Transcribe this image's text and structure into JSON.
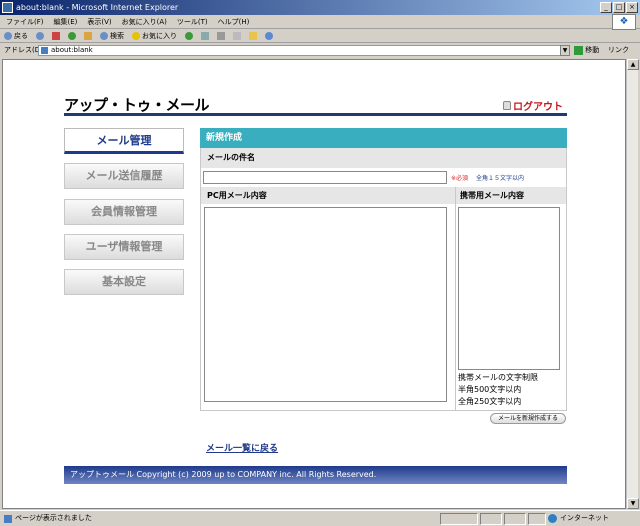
{
  "window": {
    "title": "about:blank - Microsoft Internet Explorer",
    "controls": [
      "_",
      "□",
      "×"
    ]
  },
  "menubar": [
    "ファイル(F)",
    "編集(E)",
    "表示(V)",
    "お気に入り(A)",
    "ツール(T)",
    "ヘルプ(H)"
  ],
  "toolbar": {
    "back": "戻る",
    "search": "検索",
    "favorites": "お気に入り"
  },
  "addressbar": {
    "label": "アドレス(D)",
    "url": "about:blank",
    "go": "移動",
    "links": "リンク"
  },
  "page": {
    "logo": "アップ・トゥ・メール",
    "logout": "ログアウト",
    "nav": [
      "メール管理",
      "メール送信履歴",
      "会員情報管理",
      "ユーザ情報管理",
      "基本設定"
    ],
    "panel_title": "新規作成",
    "subject_label": "メールの件名",
    "subject_value": "",
    "required": "※必須",
    "limit": "全角１５文字以内",
    "pc_label": "PC用メール内容",
    "mobile_label": "携帯用メール内容",
    "mobile_note": [
      "携帯メールの文字制限",
      "半角500文字以内",
      "全角250文字以内"
    ],
    "create_button": "メールを新規作成する",
    "back_link": "メール一覧に戻る",
    "footer": "アップトゥメール Copyright (c) 2009 up to COMPANY inc. All Rights Reserved."
  },
  "statusbar": {
    "text": "ページが表示されました",
    "zone": "インターネット"
  }
}
